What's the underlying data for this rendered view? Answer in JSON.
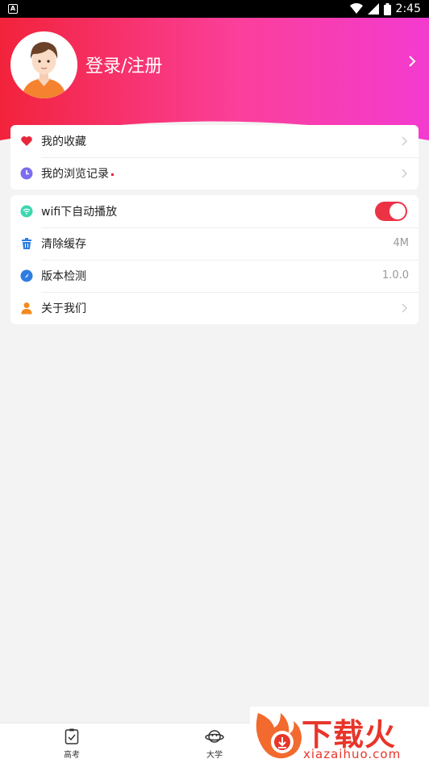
{
  "status_bar": {
    "app_badge": "A",
    "time": "2:45",
    "icons": [
      "wifi-icon",
      "cellular-signal-icon",
      "battery-icon"
    ]
  },
  "header": {
    "login_text": "登录/注册",
    "avatar_icon": "user-avatar",
    "gradient_colors": [
      "#f2233b",
      "#fb3f9a",
      "#f33bd0"
    ]
  },
  "menu_group_1": [
    {
      "label": "我的收藏",
      "icon": "heart-icon",
      "icon_color": "#e8283a"
    },
    {
      "label": "我的浏览记录",
      "icon": "clock-icon",
      "icon_color": "#7b6cf0",
      "has_dot": true
    }
  ],
  "menu_group_2": {
    "autoplay": {
      "label": "wifi下自动播放",
      "icon": "wifi-circle-icon",
      "icon_color": "#3dd6b0",
      "enabled": true
    },
    "clear_cache": {
      "label": "清除缓存",
      "icon": "trash-icon",
      "icon_color": "#2f7de1",
      "value": "4M"
    },
    "version": {
      "label": "版本检测",
      "icon": "check-circle-icon",
      "icon_color": "#2f7de1",
      "value": "1.0.0"
    },
    "about": {
      "label": "关于我们",
      "icon": "person-icon",
      "icon_color": "#f28b1e"
    }
  },
  "tab_bar": [
    {
      "label": "高考",
      "icon": "clipboard-check-icon"
    },
    {
      "label": "大学",
      "icon": "planet-icon"
    }
  ],
  "watermark": {
    "title": "下载火",
    "subtitle": "xiazaihuo.com"
  },
  "colors": {
    "accent": "#ec3245",
    "background": "#f3f3f3"
  }
}
